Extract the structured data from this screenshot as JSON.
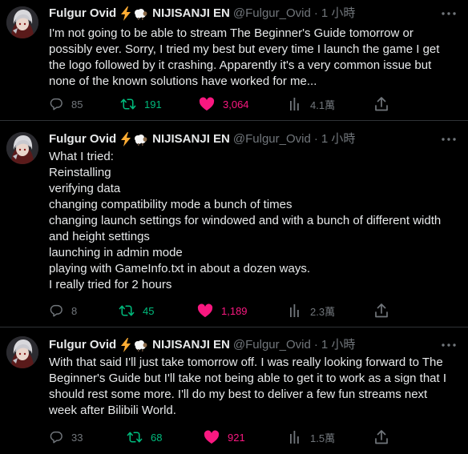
{
  "author": {
    "name": "Fulgur Ovid",
    "affiliation": "NIJISANJI EN",
    "handle": "@Fulgur_Ovid",
    "emoji_icons": [
      "lightning-icon",
      "sheep-icon"
    ]
  },
  "colors": {
    "background": "#000000",
    "text": "#e7e9ea",
    "muted": "#71767b",
    "retweet": "#00ba7c",
    "like": "#f91880",
    "divider": "#2f3336"
  },
  "tweets": [
    {
      "time": "1 小時",
      "lines": [
        "I'm not going to be able to stream The Beginner's Guide tomorrow or",
        "possibly ever. Sorry, I tried my best but every time I launch the game I get",
        "the logo followed by it crashing. Apparently it's a very common issue but",
        "none of the known solutions have worked for me..."
      ],
      "replies": "85",
      "retweets": "191",
      "likes": "3,064",
      "views": "4.1萬",
      "liked": true
    },
    {
      "time": "1 小時",
      "lines": [
        "What I tried:",
        "Reinstalling",
        "verifying data",
        "changing compatibility mode a bunch of times",
        "changing launch settings for windowed and with a bunch of different width",
        "and height settings",
        "launching in admin mode",
        "playing with GameInfo.txt in about a dozen ways.",
        "I really tried for 2 hours"
      ],
      "replies": "8",
      "retweets": "45",
      "likes": "1,189",
      "views": "2.3萬",
      "liked": true
    },
    {
      "time": "1 小時",
      "lines": [
        "With that said I'll just take tomorrow off. I was really looking forward to The",
        "Beginner's Guide but I'll take not being able to get it to work as a sign that I",
        "should rest some more. I'll do my best to deliver a few fun streams next",
        "week after Bilibili World."
      ],
      "replies": "33",
      "retweets": "68",
      "likes": "921",
      "views": "1.5萬",
      "liked": true
    }
  ]
}
